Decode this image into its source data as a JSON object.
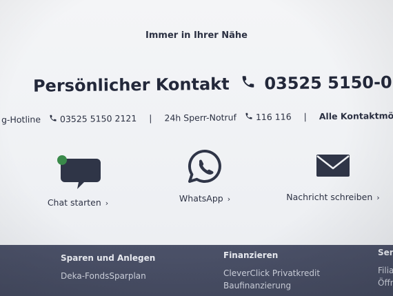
{
  "section": {
    "eyebrow": "Immer in Ihrer Nähe",
    "headline_text": "Persönlicher Kontakt",
    "headline_phone": "03525 5150-0"
  },
  "hotlines": {
    "item1_label": "g-Hotline",
    "item1_phone": "03525 5150 2121",
    "separator": "|",
    "item2_label": "24h Sperr-Notruf",
    "item2_phone": "116 116",
    "item3_label": "Alle Kontaktmö"
  },
  "actions": [
    {
      "label": "Chat starten",
      "icon": "chat-bubble-icon"
    },
    {
      "label": "WhatsApp",
      "icon": "whatsapp-icon"
    },
    {
      "label": "Nachricht schreiben",
      "icon": "envelope-icon"
    }
  ],
  "chevron": "›",
  "footer": {
    "col1": {
      "head": "Sparen und Anlegen",
      "items": [
        "Deka-FondsSparplan"
      ]
    },
    "col2": {
      "head": "Finanzieren",
      "items": [
        "CleverClick Privatkredit",
        "Baufinanzierung"
      ]
    },
    "col3": {
      "head": "Ser",
      "items": [
        "Filia",
        "Öffn"
      ]
    }
  },
  "colors": {
    "icon_dark": "#2f3547",
    "chat_dot": "#3a8a4a",
    "footer_bg": "#4b5168"
  }
}
